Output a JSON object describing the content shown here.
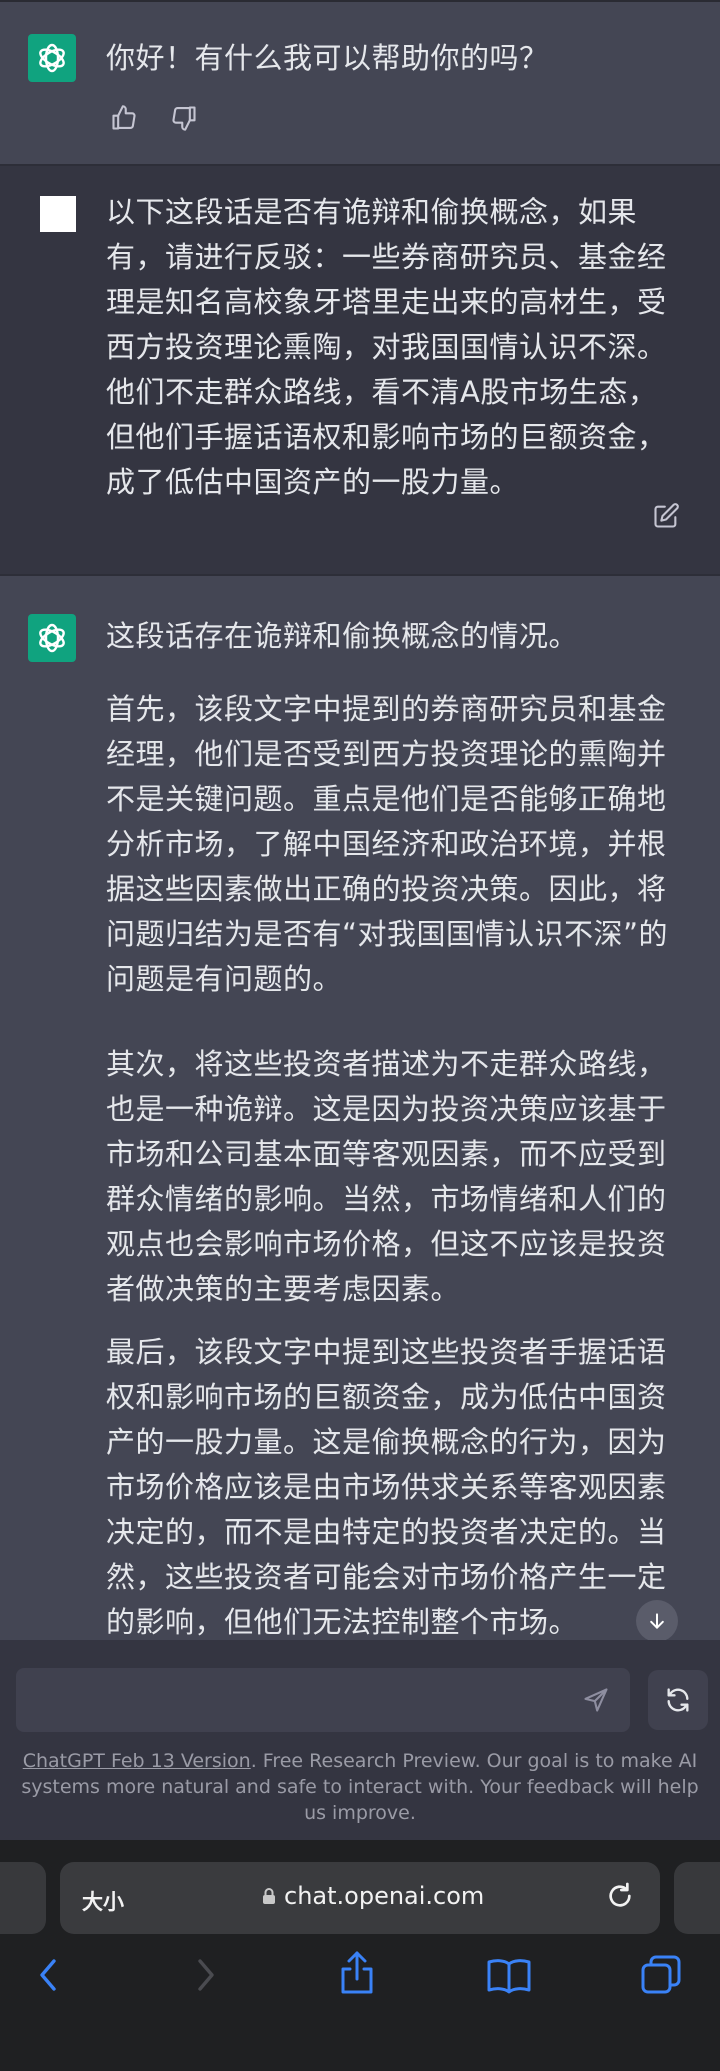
{
  "messages": {
    "greeting": "你好！有什么我可以帮助你的吗？",
    "user": "以下这段话是否有诡辩和偷换概念，如果有，请进行反驳：一些券商研究员、基金经理是知名高校象牙塔里走出来的高材生，受西方投资理论熏陶，对我国国情认识不深。他们不走群众路线，看不清A股市场生态，但他们手握话语权和影响市场的巨额资金，成了低估中国资产的一股力量。",
    "reply": [
      "这段话存在诡辩和偷换概念的情况。",
      "首先，该段文字中提到的券商研究员和基金经理，他们是否受到西方投资理论的熏陶并不是关键问题。重点是他们是否能够正确地分析市场，了解中国经济和政治环境，并根据这些因素做出正确的投资决策。因此，将问题归结为是否有“对我国国情认识不深”的问题是有问题的。",
      "其次，将这些投资者描述为不走群众路线，也是一种诡辩。这是因为投资决策应该基于市场和公司基本面等客观因素，而不应受到群众情绪的影响。当然，市场情绪和人们的观点也会影响市场价格，但这不应该是投资者做决策的主要考虑因素。",
      "最后，该段文字中提到这些投资者手握话语权和影响市场的巨额资金，成为低估中国资产的一股力量。这是偷换概念的行为，因为市场价格应该是由市场供求关系等客观因素决定的，而不是由特定的投资者决定的。当然，这些投资者可能会对市场价格产生一定的影响，但他们无法控制整个市场。"
    ]
  },
  "input": {
    "placeholder": ""
  },
  "footer": {
    "version_link": "ChatGPT Feb 13 Version",
    "note": ". Free Research Preview. Our goal is to make AI systems more natural and safe to interact with. Your feedback will help us improve."
  },
  "browser": {
    "size_label": "大小",
    "url": "chat.openai.com"
  },
  "icons": {
    "like": "thumbs-up-icon",
    "dislike": "thumbs-down-icon",
    "edit": "edit-icon",
    "send": "send-icon",
    "regenerate": "regenerate-icon",
    "scroll": "arrow-down-icon",
    "lock": "lock-icon",
    "reload": "reload-icon",
    "back": "back-icon",
    "forward": "forward-icon",
    "share": "share-icon",
    "bookmarks": "bookmarks-icon",
    "tabs": "tabs-icon"
  },
  "colors": {
    "accent": "#10a37f",
    "assistant_bg": "#444654",
    "user_bg": "#343541",
    "nav_blue": "#3a82f7"
  }
}
